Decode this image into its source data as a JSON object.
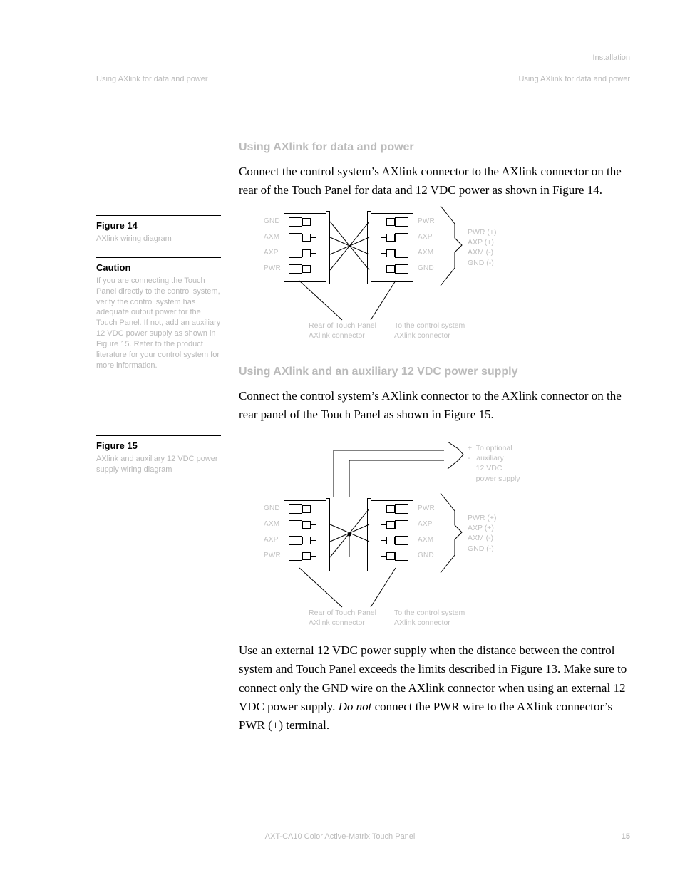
{
  "running_top": "Installation",
  "header": {
    "left": "Using AXlink for data and power",
    "right": "Using AXlink for data and power"
  },
  "section1": {
    "heading": "Using AXlink for data and power",
    "para": "Connect the control system’s AXlink connector to the AXlink connector on the rear of the Touch Panel for data and 12 VDC power as shown in Figure 14."
  },
  "fig14": {
    "label": "Figure 14",
    "caption": "AXlink wiring diagram",
    "caution_label": "Caution",
    "caution_text": "If you are connecting the Touch Panel directly to the control system, verify the control system has adequate output power for the Touch Panel. If not, add an auxiliary 12 VDC power supply as shown in Figure 15. Refer to the product literature for your control system for more information.",
    "left_conn": "Rear of Touch Panel AXlink connector",
    "right_conn": "To the control system AXlink connector",
    "brace": "PWR (+)\nAXP (+)\nAXM (-)\nGND (-)",
    "pins_left": [
      "GND",
      "AXM",
      "AXP",
      "PWR"
    ],
    "pins_right": [
      "PWR",
      "AXP",
      "AXM",
      "GND"
    ]
  },
  "section2": {
    "heading": "Using AXlink and an auxiliary 12 VDC power supply",
    "para": "Connect the control system’s AXlink connector to the AXlink connector on the rear panel of the Touch Panel as shown in Figure 15."
  },
  "fig15": {
    "label": "Figure 15",
    "caption": "AXlink and auxiliary 12 VDC power supply wiring diagram",
    "left_conn": "Rear of Touch Panel AXlink connector",
    "right_conn": "To the control system AXlink connector",
    "top_brace": "+  To optional\n-   auxiliary\n    12 VDC\n    power supply",
    "brace": "PWR (+)\nAXP (+)\nAXM (-)\nGND (-)",
    "pins_left": [
      "GND",
      "AXM",
      "AXP",
      "PWR"
    ],
    "pins_right": [
      "PWR",
      "AXP",
      "AXM",
      "GND"
    ]
  },
  "section3": {
    "para_a": "Use an external 12 VDC power supply when the distance between the control system and Touch Panel exceeds the limits described in Figure 13. Make sure to connect only the GND wire on the AXlink connector when using an external 12 VDC power supply. ",
    "em": "Do not",
    "para_b": " connect the PWR wire to the AXlink connector’s PWR (+) terminal."
  },
  "footer": {
    "center": "AXT-CA10 Color Active-Matrix Touch Panel",
    "right": "15"
  }
}
